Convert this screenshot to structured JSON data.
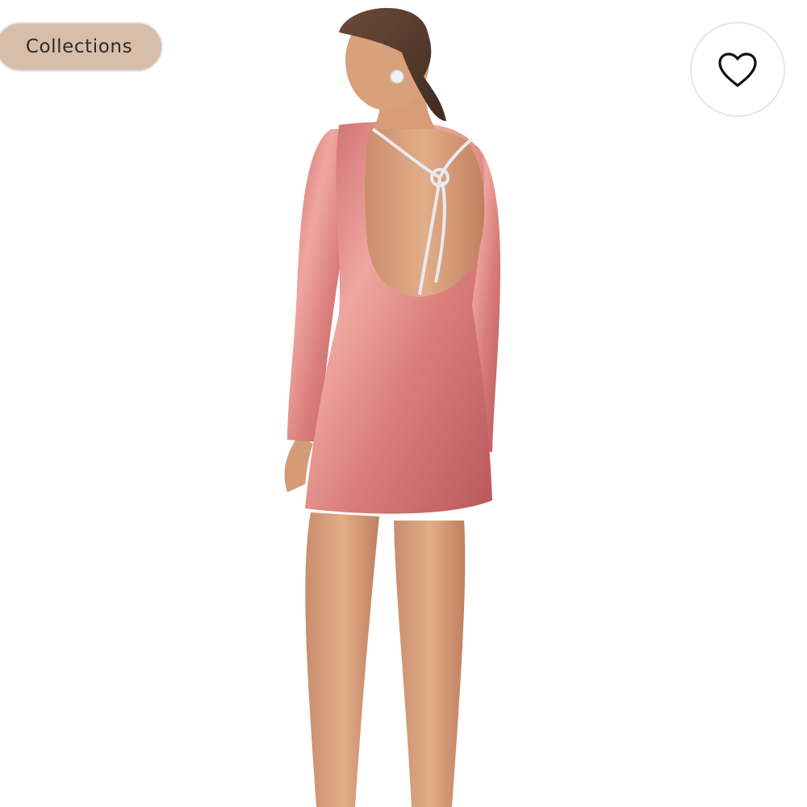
{
  "product": {
    "image_icon": "dress-photo",
    "colors": {
      "dress": "#d97f7b",
      "skin": "#d9a07c",
      "hair": "#5a3f31"
    }
  },
  "overlay": {
    "collections_label": "Collections",
    "pill_color": "#d8bea9",
    "favorite_icon": "heart-outline-icon"
  }
}
